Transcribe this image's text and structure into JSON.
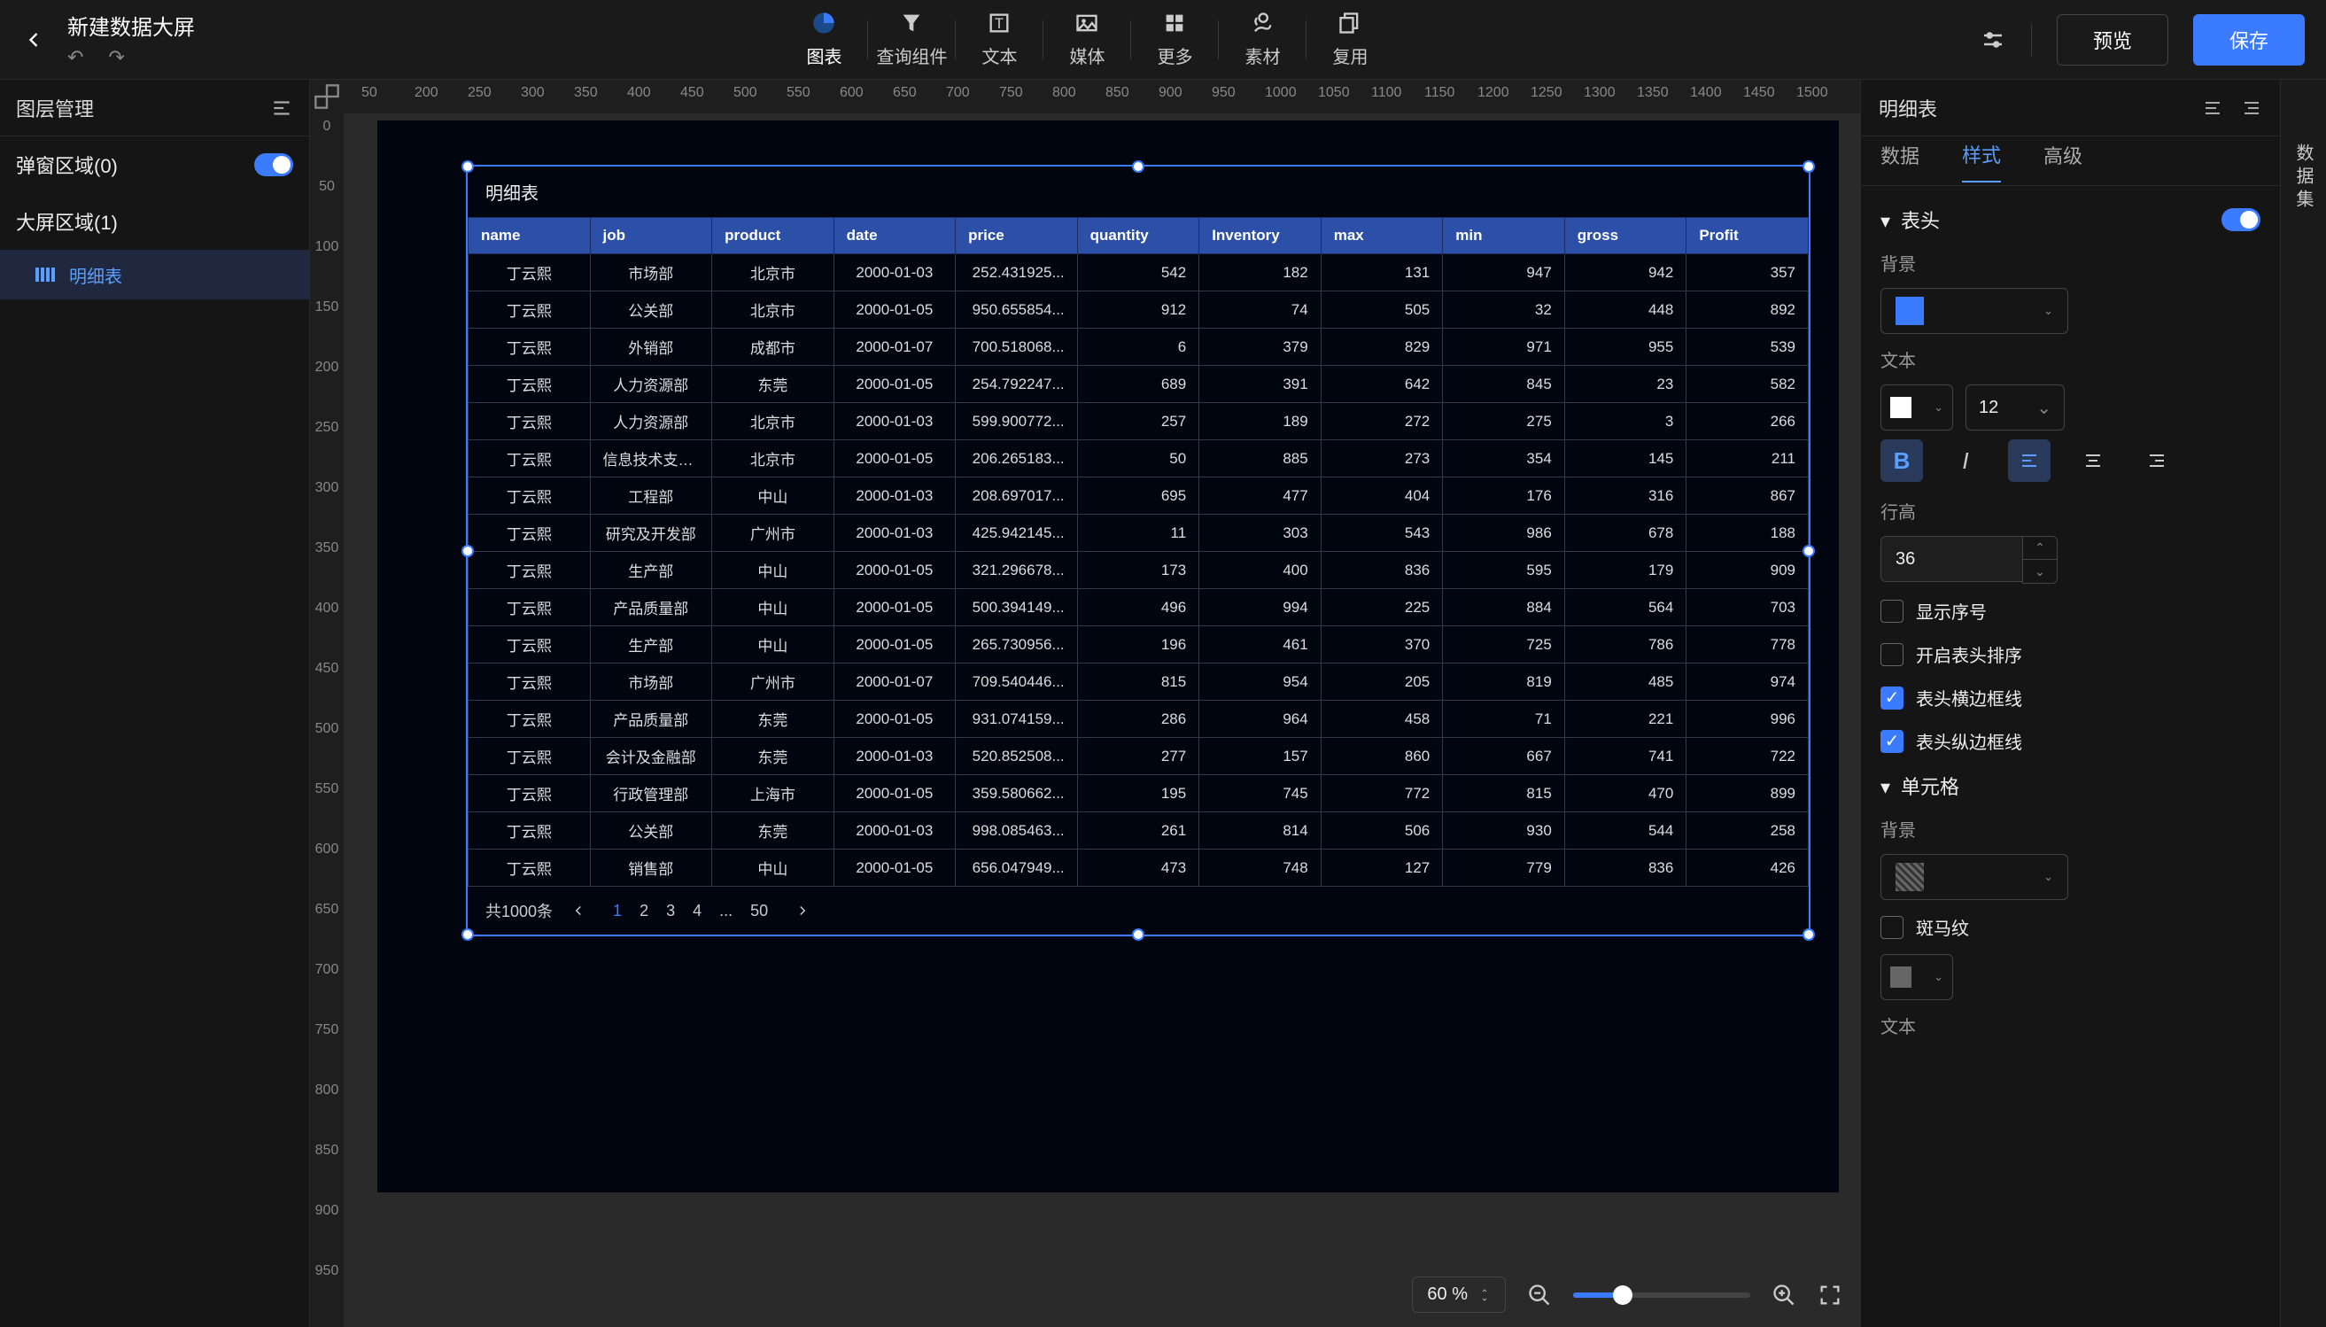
{
  "doc": {
    "title": "新建数据大屏"
  },
  "toolbar": {
    "tools": [
      "图表",
      "查询组件",
      "文本",
      "媒体",
      "更多",
      "素材",
      "复用"
    ],
    "active": 0,
    "preview": "预览",
    "save": "保存"
  },
  "left": {
    "title": "图层管理",
    "popup_area": "弹窗区域(0)",
    "screen_area": "大屏区域(1)",
    "layer_name": "明细表"
  },
  "widget": {
    "title": "明细表",
    "headers": [
      "name",
      "job",
      "product",
      "date",
      "price",
      "quantity",
      "Inventory",
      "max",
      "min",
      "gross",
      "Profit"
    ],
    "rows": [
      [
        "丁云熙",
        "市场部",
        "北京市",
        "2000-01-03",
        "252.431925...",
        "542",
        "182",
        "131",
        "947",
        "942",
        "357"
      ],
      [
        "丁云熙",
        "公关部",
        "北京市",
        "2000-01-05",
        "950.655854...",
        "912",
        "74",
        "505",
        "32",
        "448",
        "892"
      ],
      [
        "丁云熙",
        "外销部",
        "成都市",
        "2000-01-07",
        "700.518068...",
        "6",
        "379",
        "829",
        "971",
        "955",
        "539"
      ],
      [
        "丁云熙",
        "人力资源部",
        "东莞",
        "2000-01-05",
        "254.792247...",
        "689",
        "391",
        "642",
        "845",
        "23",
        "582"
      ],
      [
        "丁云熙",
        "人力资源部",
        "北京市",
        "2000-01-03",
        "599.900772...",
        "257",
        "189",
        "272",
        "275",
        "3",
        "266"
      ],
      [
        "丁云熙",
        "信息技术支持部",
        "北京市",
        "2000-01-05",
        "206.265183...",
        "50",
        "885",
        "273",
        "354",
        "145",
        "211"
      ],
      [
        "丁云熙",
        "工程部",
        "中山",
        "2000-01-03",
        "208.697017...",
        "695",
        "477",
        "404",
        "176",
        "316",
        "867"
      ],
      [
        "丁云熙",
        "研究及开发部",
        "广州市",
        "2000-01-03",
        "425.942145...",
        "11",
        "303",
        "543",
        "986",
        "678",
        "188"
      ],
      [
        "丁云熙",
        "生产部",
        "中山",
        "2000-01-05",
        "321.296678...",
        "173",
        "400",
        "836",
        "595",
        "179",
        "909"
      ],
      [
        "丁云熙",
        "产品质量部",
        "中山",
        "2000-01-05",
        "500.394149...",
        "496",
        "994",
        "225",
        "884",
        "564",
        "703"
      ],
      [
        "丁云熙",
        "生产部",
        "中山",
        "2000-01-05",
        "265.730956...",
        "196",
        "461",
        "370",
        "725",
        "786",
        "778"
      ],
      [
        "丁云熙",
        "市场部",
        "广州市",
        "2000-01-07",
        "709.540446...",
        "815",
        "954",
        "205",
        "819",
        "485",
        "974"
      ],
      [
        "丁云熙",
        "产品质量部",
        "东莞",
        "2000-01-05",
        "931.074159...",
        "286",
        "964",
        "458",
        "71",
        "221",
        "996"
      ],
      [
        "丁云熙",
        "会计及金融部",
        "东莞",
        "2000-01-03",
        "520.852508...",
        "277",
        "157",
        "860",
        "667",
        "741",
        "722"
      ],
      [
        "丁云熙",
        "行政管理部",
        "上海市",
        "2000-01-05",
        "359.580662...",
        "195",
        "745",
        "772",
        "815",
        "470",
        "899"
      ],
      [
        "丁云熙",
        "公关部",
        "东莞",
        "2000-01-03",
        "998.085463...",
        "261",
        "814",
        "506",
        "930",
        "544",
        "258"
      ],
      [
        "丁云熙",
        "销售部",
        "中山",
        "2000-01-05",
        "656.047949...",
        "473",
        "748",
        "127",
        "779",
        "836",
        "426"
      ]
    ],
    "pager": {
      "total": "共1000条",
      "pages": [
        "1",
        "2",
        "3",
        "4",
        "...",
        "50"
      ],
      "current": 0
    }
  },
  "zoom": {
    "value": "60 %"
  },
  "right": {
    "title": "明细表",
    "tabs": [
      "数据",
      "样式",
      "高级"
    ],
    "active": 1,
    "sect_header": "表头",
    "bg_label": "背景",
    "text_label": "文本",
    "font_size": "12",
    "line_height_label": "行高",
    "line_height_value": "36",
    "chk_show_index": "显示序号",
    "chk_enable_sort": "开启表头排序",
    "chk_h_border": "表头横边框线",
    "chk_v_border": "表头纵边框线",
    "sect_cell": "单元格",
    "chk_zebra": "斑马纹",
    "header_swatch": "#3a7bff",
    "text_swatch": "#ffffff",
    "cell_swatch": "#666666"
  },
  "rside": {
    "dataset": "数据集"
  },
  "hruler_ticks": [
    "50",
    "200",
    "250",
    "300",
    "350",
    "400",
    "450",
    "500",
    "550",
    "600",
    "650",
    "700",
    "750",
    "800",
    "850",
    "900",
    "950",
    "1000",
    "1050",
    "1100",
    "1150",
    "1200",
    "1250",
    "1300",
    "1350",
    "1400",
    "1450",
    "1500"
  ],
  "vruler_ticks": [
    "0",
    "50",
    "100",
    "150",
    "200",
    "250",
    "300",
    "350",
    "400",
    "450",
    "500",
    "550",
    "600",
    "650",
    "700",
    "750",
    "800",
    "850",
    "900",
    "950"
  ]
}
